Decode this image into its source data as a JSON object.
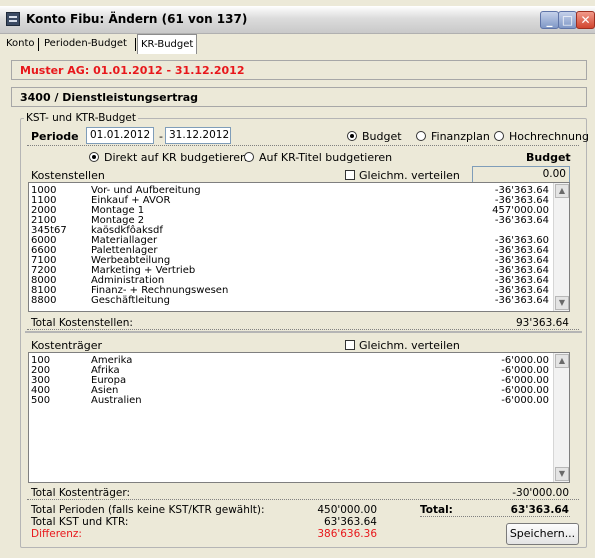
{
  "window": {
    "title": "Konto Fibu: Ändern (61 von 137)",
    "controls": {
      "minimize": "_",
      "maximize": "□",
      "close": "✕"
    }
  },
  "tabs": [
    "Konto",
    "Perioden-Budget",
    "KR-Budget"
  ],
  "header": {
    "company_period": "Muster AG: 01.01.2012 - 31.12.2012",
    "account": "3400 / Dienstleistungsertrag"
  },
  "group": {
    "label": "KST- und KTR-Budget",
    "periode_label": "Periode",
    "period_from": "01.01.2012",
    "period_sep": "-",
    "period_to": "31.12.2012",
    "radios_top": [
      "Budget",
      "Finanzplan",
      "Hochrechnung"
    ],
    "radios_mode": [
      "Direkt auf KR budgetieren",
      "Auf KR-Titel budgetieren"
    ],
    "budget_header": "Budget"
  },
  "kostenstellen": {
    "label": "Kostenstellen",
    "equal_label": "Gleichm. verteilen",
    "budget_input": "0.00",
    "rows": [
      [
        "1000",
        "Vor- und Aufbereitung",
        "-36'363.64"
      ],
      [
        "1100",
        "Einkauf + AVOR",
        "-36'363.64"
      ],
      [
        "2000",
        "Montage 1",
        "457'000.00"
      ],
      [
        "2100",
        "Montage 2",
        "-36'363.64"
      ],
      [
        "345t67",
        "kaösdkfôaksdf",
        ""
      ],
      [
        "6000",
        "Materiallager",
        "-36'363.60"
      ],
      [
        "6600",
        "Palettenlager",
        "-36'363.64"
      ],
      [
        "7100",
        "Werbeabteilung",
        "-36'363.64"
      ],
      [
        "7200",
        "Marketing + Vertrieb",
        "-36'363.64"
      ],
      [
        "8000",
        "Administration",
        "-36'363.64"
      ],
      [
        "8100",
        "Finanz- + Rechnungswesen",
        "-36'363.64"
      ],
      [
        "8800",
        "Geschäftleitung",
        "-36'363.64"
      ]
    ],
    "total_label": "Total Kostenstellen:",
    "total_value": "93'363.64"
  },
  "kostentraeger": {
    "label": "Kostenträger",
    "equal_label": "Gleichm. verteilen",
    "rows": [
      [
        "100",
        "Amerika",
        "-6'000.00"
      ],
      [
        "200",
        "Afrika",
        "-6'000.00"
      ],
      [
        "300",
        "Europa",
        "-6'000.00"
      ],
      [
        "400",
        "Asien",
        "-6'000.00"
      ],
      [
        "500",
        "Australien",
        "-6'000.00"
      ]
    ],
    "total_label": "Total Kostenträger:",
    "total_value": "-30'000.00"
  },
  "summary": {
    "perioden_label": "Total Perioden (falls keine KST/KTR gewählt):",
    "perioden_value": "450'000.00",
    "total_label": "Total:",
    "total_value": "63'363.64",
    "kst_ktr_label": "Total KST und KTR:",
    "kst_ktr_value": "63'363.64",
    "diff_label": "Differenz:",
    "diff_value": "386'636.36",
    "save_label": "Speichern..."
  },
  "colors": {
    "accent_red": "#e8171b",
    "bg": "#ece9d8"
  }
}
